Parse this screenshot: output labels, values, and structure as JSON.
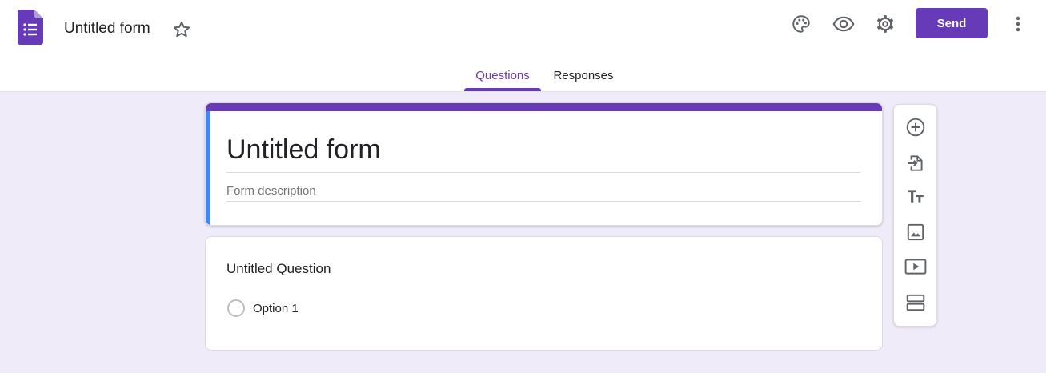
{
  "header": {
    "app_icon": "google-forms-icon",
    "doc_title": "Untitled form",
    "star_icon": "star-outline-icon",
    "actions": {
      "palette_icon": "palette-icon",
      "preview_icon": "eye-icon",
      "settings_icon": "gear-icon",
      "send_label": "Send",
      "more_icon": "more-vert-icon"
    }
  },
  "tabs": [
    {
      "label": "Questions",
      "active": true
    },
    {
      "label": "Responses",
      "active": false
    }
  ],
  "form": {
    "title": "Untitled form",
    "description_placeholder": "Form description"
  },
  "question": {
    "title": "Untitled Question",
    "options": [
      "Option 1"
    ]
  },
  "toolbar": {
    "tools": [
      "add-question-icon",
      "import-questions-icon",
      "add-title-icon",
      "add-image-icon",
      "add-video-icon",
      "add-section-icon"
    ]
  },
  "colors": {
    "accent": "#673ab7",
    "background": "#f0ebf8",
    "title_card_left_stripe": "#4285f4",
    "icon": "#5f6368"
  }
}
